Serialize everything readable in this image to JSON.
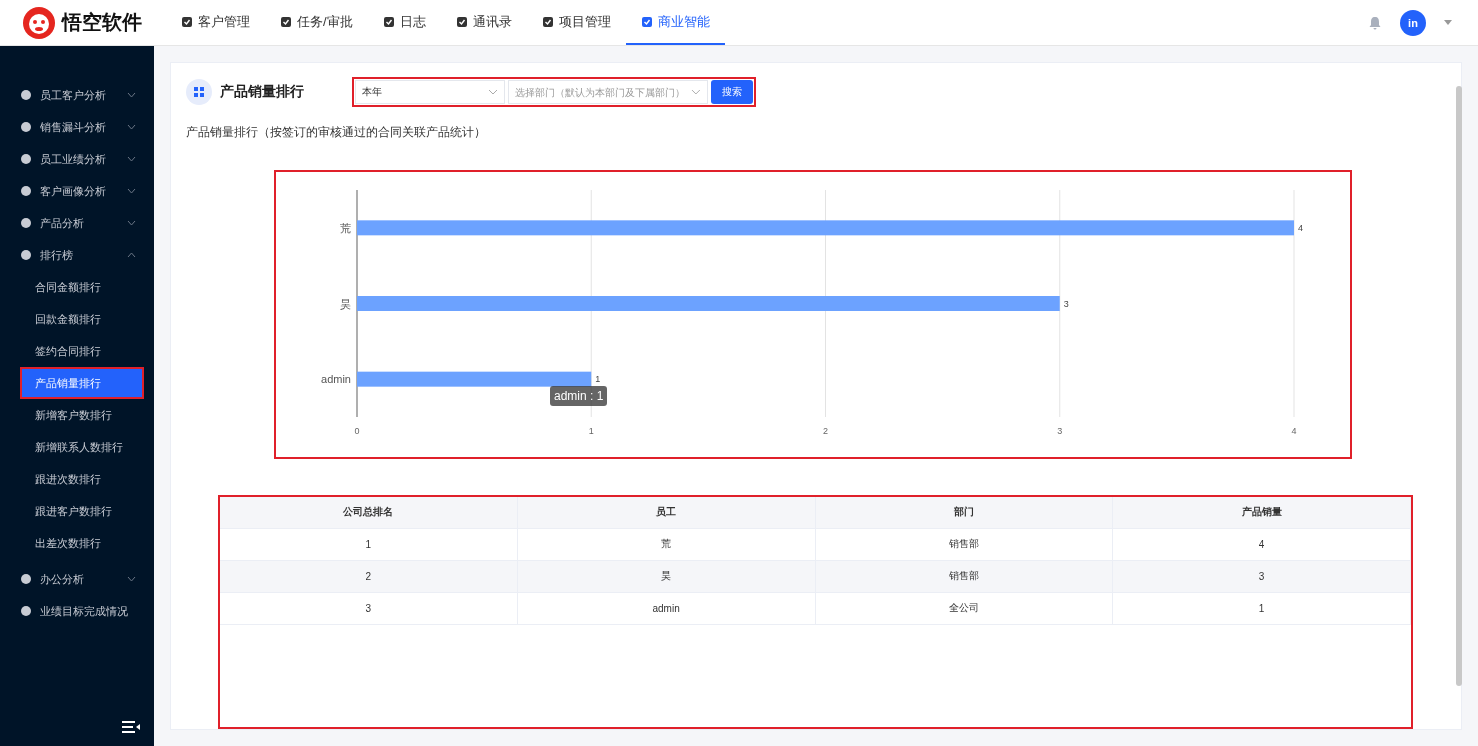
{
  "header": {
    "logo_text": "悟空软件",
    "nav": [
      {
        "label": "客户管理",
        "selected": false
      },
      {
        "label": "任务/审批",
        "selected": false
      },
      {
        "label": "日志",
        "selected": false
      },
      {
        "label": "通讯录",
        "selected": false
      },
      {
        "label": "项目管理",
        "selected": false
      },
      {
        "label": "商业智能",
        "selected": true
      }
    ],
    "avatar": "in"
  },
  "sidebar": {
    "items": [
      {
        "label": "员工客户分析",
        "expanded": false
      },
      {
        "label": "销售漏斗分析",
        "expanded": false
      },
      {
        "label": "员工业绩分析",
        "expanded": false
      },
      {
        "label": "客户画像分析",
        "expanded": false
      },
      {
        "label": "产品分析",
        "expanded": false
      },
      {
        "label": "排行榜",
        "expanded": true,
        "children": [
          {
            "label": "合同金额排行",
            "selected": false
          },
          {
            "label": "回款金额排行",
            "selected": false
          },
          {
            "label": "签约合同排行",
            "selected": false
          },
          {
            "label": "产品销量排行",
            "selected": true
          },
          {
            "label": "新增客户数排行",
            "selected": false
          },
          {
            "label": "新增联系人数排行",
            "selected": false
          },
          {
            "label": "跟进次数排行",
            "selected": false
          },
          {
            "label": "跟进客户数排行",
            "selected": false
          },
          {
            "label": "出差次数排行",
            "selected": false
          }
        ]
      },
      {
        "label": "办公分析",
        "expanded": false
      },
      {
        "label": "业绩目标完成情况"
      }
    ]
  },
  "panel": {
    "title": "产品销量排行",
    "period": "本年",
    "department": {
      "placeholder": "选择部门（默认为本部门及下属部门）"
    },
    "search_button": "搜索",
    "subtitle": "产品销量排行（按签订的审核通过的合同关联产品统计）",
    "chart_data": {
      "type": "bar",
      "orientation": "horizontal",
      "categories": [
        "荒",
        "昊",
        "admin"
      ],
      "series": [
        {
          "color": "#6ca2ff",
          "values": [
            4,
            3,
            1
          ]
        }
      ],
      "xlim": [
        0,
        4
      ],
      "xticks": [
        0,
        1,
        2,
        3,
        4
      ],
      "grid": true,
      "data_labels": true
    },
    "tooltip": "admin : 1",
    "table": {
      "columns": [
        "公司总排名",
        "员工",
        "部门",
        "产品销量"
      ],
      "rows": [
        [
          "1",
          "荒",
          "销售部",
          "4"
        ],
        [
          "2",
          "昊",
          "销售部",
          "3"
        ],
        [
          "3",
          "admin",
          "全公司",
          "1"
        ]
      ]
    }
  }
}
